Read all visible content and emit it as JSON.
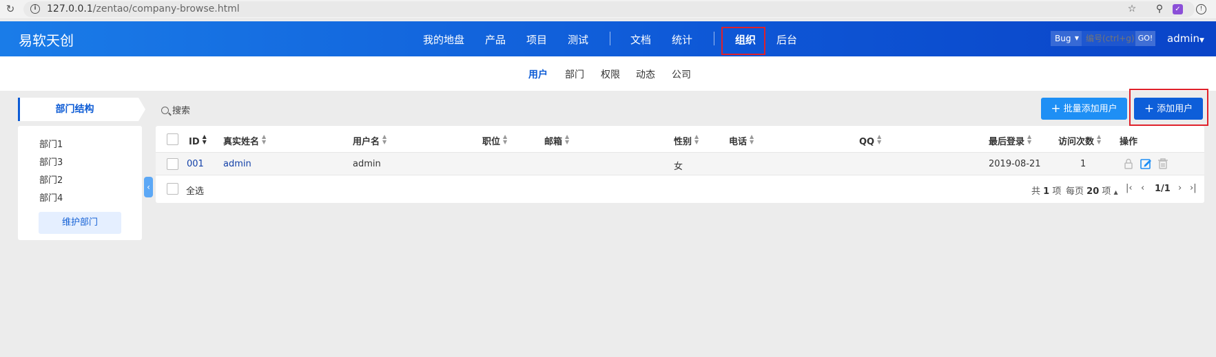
{
  "browser": {
    "url_host": "127.0.0.1",
    "url_path": "/zentao/company-browse.html"
  },
  "header": {
    "brand": "易软天创",
    "nav": [
      {
        "label": "我的地盘"
      },
      {
        "label": "产品"
      },
      {
        "label": "项目"
      },
      {
        "label": "测试"
      },
      {
        "label": "文档"
      },
      {
        "label": "统计"
      },
      {
        "label": "组织",
        "active": true
      },
      {
        "label": "后台"
      }
    ],
    "object_type": "Bug",
    "search_placeholder": "编号(ctrl+g)",
    "go_label": "GO!",
    "user": "admin"
  },
  "subnav": [
    "用户",
    "部门",
    "权限",
    "动态",
    "公司"
  ],
  "sidebar": {
    "title": "部门结构",
    "departments": [
      "部门1",
      "部门3",
      "部门2",
      "部门4"
    ],
    "maintain_label": "维护部门"
  },
  "toolbar": {
    "search_label": "搜索",
    "batch_add_label": "批量添加用户",
    "add_label": "添加用户"
  },
  "table": {
    "columns": [
      "ID",
      "真实姓名",
      "用户名",
      "职位",
      "邮箱",
      "性别",
      "电话",
      "QQ",
      "最后登录",
      "访问次数",
      "操作"
    ],
    "rows": [
      {
        "id": "001",
        "realname": "admin",
        "account": "admin",
        "role": "",
        "email": "",
        "gender": "女",
        "phone": "",
        "qq": "",
        "last_login": "2019-08-21",
        "visits": "1"
      }
    ],
    "select_all_label": "全选",
    "pager": {
      "total_prefix": "共",
      "total": "1",
      "total_suffix": "项",
      "per_page_prefix": "每页",
      "per_page": "20",
      "per_page_suffix": "项",
      "page": "1/1"
    }
  },
  "colors": {
    "header_start": "#1a7ce8",
    "header_end": "#0a44c8",
    "accent": "#0c5bd5",
    "button": "#1e8ff5",
    "highlight": "#e0202a"
  }
}
